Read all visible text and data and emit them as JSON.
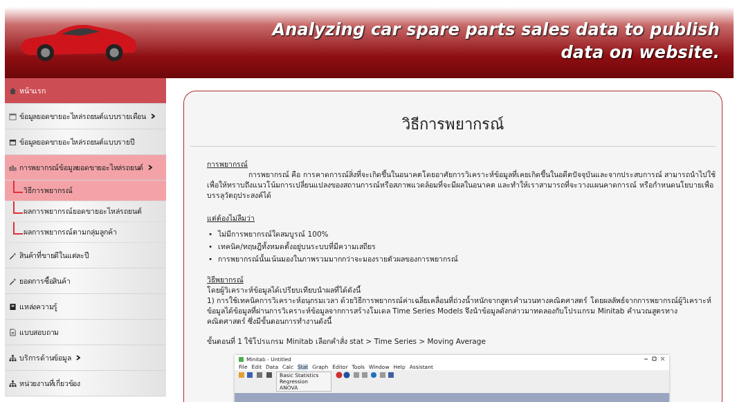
{
  "header": {
    "title_lines": [
      "Analyzing car spare parts sales data to publish",
      "data on website."
    ]
  },
  "sidebar": {
    "items": [
      {
        "label": "หน้าแรก",
        "kind": "home",
        "selected": false,
        "has_submenu": false
      },
      {
        "label": "ข้อมูลยอดขายอะไหล่รถยนต์แบบรายเดือน",
        "kind": "calendar",
        "selected": false,
        "has_submenu": true
      },
      {
        "label": "ข้อมูลยอดขายอะไหล่รถยนต์แบบรายปี",
        "kind": "calendar-filled",
        "selected": false,
        "has_submenu": false
      },
      {
        "label": "การพยากรณ์ข้อมูลยอดขายอะไหล่รถยนต์",
        "kind": "chart",
        "selected": false,
        "has_submenu": true,
        "expanded": true,
        "children": [
          {
            "label": "วิธีการพยากรณ์",
            "selected": true
          },
          {
            "label": "ผลการพยากรณ์ยอดขายอะไหล่รถยนต์",
            "selected": false
          },
          {
            "label": "ผลการพยากรณ์ตามกลุ่มลูกค้า",
            "selected": false
          }
        ]
      },
      {
        "label": "สินค้าที่ขายดีในแต่ละปี",
        "kind": "wand",
        "selected": false,
        "has_submenu": false
      },
      {
        "label": "ยอดการซื้อสินค้า",
        "kind": "wand",
        "selected": false,
        "has_submenu": false
      },
      {
        "label": "แหล่งความรู้",
        "kind": "book",
        "selected": false,
        "has_submenu": false
      },
      {
        "label": "แบบสอบถาม",
        "kind": "document",
        "selected": false,
        "has_submenu": false
      },
      {
        "label": "บริการด้านข้อมูล",
        "kind": "sitemap",
        "selected": false,
        "has_submenu": true
      },
      {
        "label": "หน่วยงานที่เกี่ยวข้อง",
        "kind": "sitemap",
        "selected": false,
        "has_submenu": false
      }
    ]
  },
  "content": {
    "title": "วิธีการพยากรณ์",
    "blocks": [
      {
        "kind": "heading",
        "text": "การพยากรณ์"
      },
      {
        "kind": "paragraph",
        "indent": true,
        "text": "การพยากรณ์ คือ การคาดการณ์สิ่งที่จะเกิดขึ้นในอนาคตโดยอาศัยการวิเคราะห์ข้อมูลที่เคยเกิดขึ้นในอดีตปัจจุบันและจากประสบการณ์ สามารถนำไปใช้เพื่อให้ทราบถึงแนวโน้มการเปลี่ยนแปลงของสถานการณ์หรือสภาพแวดล้อมที่จะมีผลในอนาคต และทำให้เราสามารถที่จะวางแผนคาดการณ์ หรือกำหนดนโยบายเพื่อบรรลุวัตถุประสงค์ได้"
      },
      {
        "kind": "heading",
        "text": "แต่ต้องไม่ลืมว่า"
      },
      {
        "kind": "bullets",
        "items": [
          {
            "marker": "•",
            "text": "ไม่มีการพยากรณ์ใดสมบูรณ์ 100%"
          },
          {
            "marker": "•",
            "text": "เทคนิค/ทฤษฎีทั้งหมดตั้งอยู่บนระบบที่มีความเสถียร"
          },
          {
            "marker": "•",
            "text": "การพยากรณ์นั้นเน้นมองในภาพรวมมากกว่าจะมองรายตัวผลของการพยากรณ์"
          }
        ]
      },
      {
        "kind": "heading",
        "text": "วิธีพยากรณ์"
      },
      {
        "kind": "paragraph",
        "indent": false,
        "text": "โดยผู้วิเคราะห์ข้อมูลได้เปรียบเทียบนำผลที่ได้ดังนี้"
      },
      {
        "kind": "paragraph",
        "indent": false,
        "text": "1) การใช้เทคนิคการวิเคราะห์อนุกรมเวลา ด้วยวิธีการพยากรณ์ค่าเฉลี่ยเคลื่อนที่ถ่วงน้ำหนักจากสูตรคำนวนทางคณิตศาสตร์ โดยผลลัพธ์จากการพยากรณ์ผู้วิเคราะห์ข้อมูลได้ข้อมูลที่ผ่านการวิเคราะห์ข้อมูลจากการสร้างโมเดล Time Series Models จึงนำข้อมูลดังกล่าวมาทดลองกับโปรแกรม Minitab คำนวณสูตรทางคณิตศาสตร์ ซึ่งมีขั้นตอนการทำงานดังนี้"
      },
      {
        "kind": "step",
        "text": "ขั้นตอนที่ 1 ใช้โปรแกรม Minitab เลือกคำสั่ง stat > Time Series > Moving Average"
      }
    ],
    "screenshot": {
      "title": "Minitab - Untitled",
      "menu": [
        {
          "label": "File",
          "selected": false
        },
        {
          "label": "Edit",
          "selected": false
        },
        {
          "label": "Data",
          "selected": false
        },
        {
          "label": "Calc",
          "selected": false
        },
        {
          "label": "Stat",
          "selected": true
        },
        {
          "label": "Graph",
          "selected": false
        },
        {
          "label": "Editor",
          "selected": false
        },
        {
          "label": "Tools",
          "selected": false
        },
        {
          "label": "Window",
          "selected": false
        },
        {
          "label": "Help",
          "selected": false
        },
        {
          "label": "Assistant",
          "selected": false
        }
      ],
      "dropdown": [
        "Basic Statistics",
        "Regression",
        "ANOVA"
      ]
    }
  }
}
